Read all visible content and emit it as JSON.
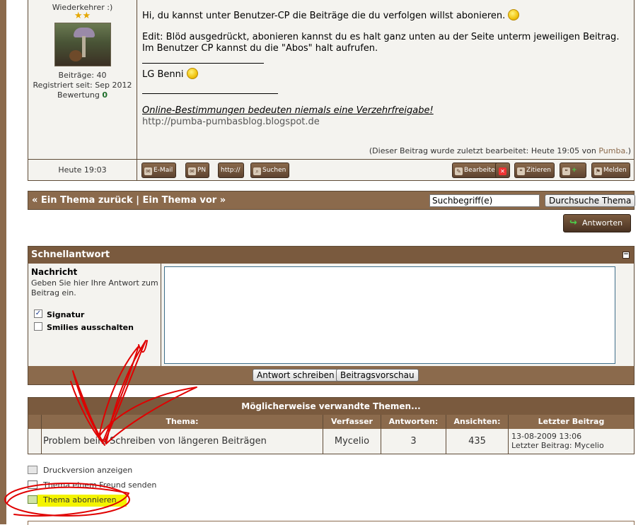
{
  "post": {
    "user_rank": "Wiederkehrer :)",
    "stars": "★★",
    "posts_count": "Beiträge: 40",
    "registered": "Registriert seit: Sep 2012",
    "rating_label": "Bewertung",
    "rating_value": "0",
    "msg_line1": "Hi, du kannst unter Benutzer-CP die Beiträge die du verfolgen willst abonieren.",
    "msg_line2": "Edit: Blöd ausgedrückt, abonieren kannst du es halt ganz unten au der Seite unterm jeweiligen Beitrag.",
    "msg_line3": "Im Benutzer CP kannst du die \"Abos\" halt aufrufen.",
    "greeting": "LG Benni",
    "sig_italic": "Online-Bestimmungen bedeuten niemals eine Verzehrfreigabe!",
    "sig_url": "http://pumba-pumbasblog.blogspot.de",
    "edited_prefix": "(Dieser Beitrag wurde zuletzt bearbeitet: Heute 19:05 von",
    "edited_by": "Pumba",
    "edited_suffix": ".)",
    "time": "Heute 19:03",
    "buttons": {
      "email": "E-Mail",
      "pm": "PN",
      "www": "http://",
      "search": "Suchen",
      "edit": "Bearbeiten",
      "quote": "Zitieren",
      "report": "Melden"
    }
  },
  "nav": {
    "prev": "« Ein Thema zurück",
    "sep": " | ",
    "next": "Ein Thema vor »",
    "search_placeholder": "Suchbegriff(e)",
    "search_button": "Durchsuche Thema",
    "reply_button": "Antworten"
  },
  "quick_reply": {
    "title": "Schnellantwort",
    "collapse": "−",
    "message_label": "Nachricht",
    "message_desc": "Geben Sie hier Ihre Antwort zum Beitrag ein.",
    "signature_label": "Signatur",
    "signature_checked": "✓",
    "disable_smilies_label": "Smilies ausschalten",
    "submit_button": "Antwort schreiben",
    "preview_button": "Beitragsvorschau"
  },
  "related": {
    "title": "Möglicherweise verwandte Themen...",
    "columns": [
      "Thema:",
      "Verfasser",
      "Antworten:",
      "Ansichten:",
      "Letzter Beitrag"
    ],
    "rows": [
      {
        "topic": "Problem beim Schreiben von längeren Beiträgen",
        "author": "Mycelio",
        "replies": "3",
        "views": "435",
        "last_date": "13-08-2009 13:06",
        "last_by": "Letzter Beitrag: Mycelio"
      }
    ]
  },
  "tools": {
    "print": "Druckversion anzeigen",
    "send": "Thema einem Freund senden",
    "subscribe": "Thema abonnieren"
  },
  "colors": {
    "accent_brown": "#8b6a4c",
    "header_brown": "#7a5a3e",
    "highlight": "#f4f400",
    "annotation_red": "#e00000"
  }
}
